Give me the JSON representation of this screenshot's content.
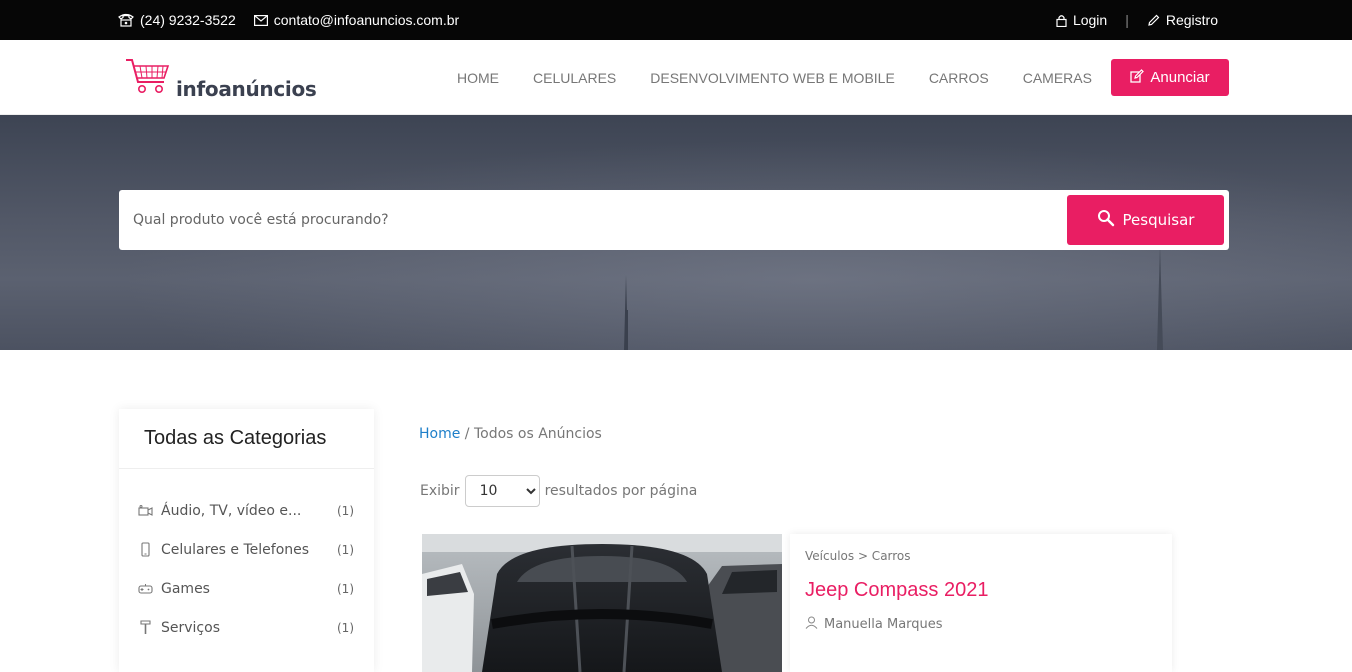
{
  "topbar": {
    "phone": "(24) 9232-3522",
    "email": "contato@infoanuncios.com.br",
    "login": "Login",
    "separator": "|",
    "register": "Registro"
  },
  "header": {
    "logo_text": "infoanúncios",
    "nav": [
      "HOME",
      "CELULARES",
      "DESENVOLVIMENTO WEB E MOBILE",
      "CARROS",
      "CAMERAS"
    ],
    "cta_label": "Anunciar"
  },
  "hero": {
    "search_placeholder": "Qual produto você está procurando?",
    "search_button": "Pesquisar"
  },
  "sidebar": {
    "title": "Todas as Categorias",
    "categories": [
      {
        "label": "Áudio, TV, vídeo e...",
        "count": "(1)",
        "icon": "camera-icon"
      },
      {
        "label": "Celulares e Telefones",
        "count": "(1)",
        "icon": "phone-icon"
      },
      {
        "label": "Games",
        "count": "(1)",
        "icon": "gamepad-icon"
      },
      {
        "label": "Serviços",
        "count": "(1)",
        "icon": "tools-icon"
      }
    ]
  },
  "main": {
    "breadcrumb": {
      "home": "Home",
      "separator": "/",
      "current": "Todos os Anúncios"
    },
    "per_page": {
      "prefix": "Exibir",
      "selected": "10",
      "suffix": "resultados por página"
    },
    "ad": {
      "category_path": "Veículos > Carros",
      "title": "Jeep Compass 2021",
      "seller": "Manuella Marques"
    }
  },
  "colors": {
    "accent": "#e91e63",
    "topbar_bg": "#060606",
    "link": "#1e7fc9"
  }
}
